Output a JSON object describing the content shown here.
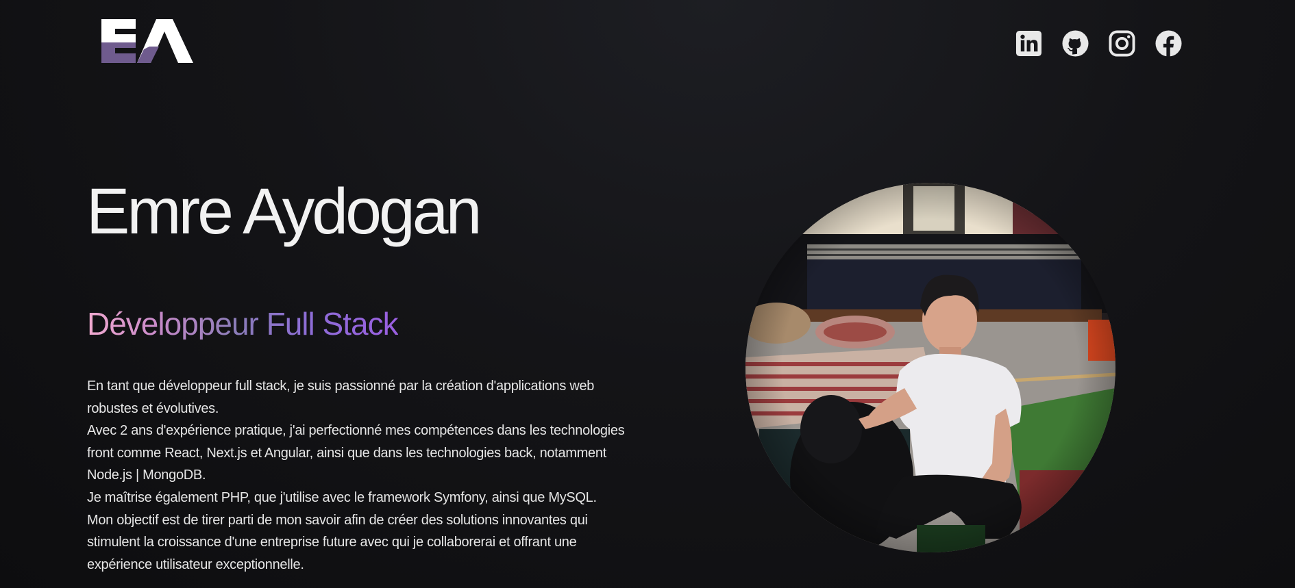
{
  "header": {
    "logo_alt": "EA",
    "socials": [
      {
        "name": "LinkedIn",
        "icon": "linkedin-icon"
      },
      {
        "name": "GitHub",
        "icon": "github-icon"
      },
      {
        "name": "Instagram",
        "icon": "instagram-icon"
      },
      {
        "name": "Facebook",
        "icon": "facebook-icon"
      }
    ]
  },
  "hero": {
    "name": "Emre Aydogan",
    "role": "Développeur Full Stack",
    "bio": [
      "En tant que développeur full stack, je suis passionné par la création d'applications web robustes et évolutives.",
      "Avec 2 ans d'expérience pratique, j'ai perfectionné mes compétences dans les technologies front comme React, Next.js et Angular, ainsi que dans les technologies back, notamment Node.js | MongoDB.",
      "Je maîtrise également PHP, que j'utilise avec le framework Symfony, ainsi que MySQL.",
      "Mon objectif est de tirer parti de mon savoir afin de créer des solutions innovantes qui stimulent la croissance d'une entreprise future avec qui je collaborerai et offrant une expérience utilisateur exceptionnelle."
    ]
  },
  "colors": {
    "background": "#121215",
    "text": "#eaeaea",
    "gradient_start": "#f0a9cf",
    "gradient_end": "#9a5fe0",
    "logo_purple": "#6e5a8c"
  }
}
